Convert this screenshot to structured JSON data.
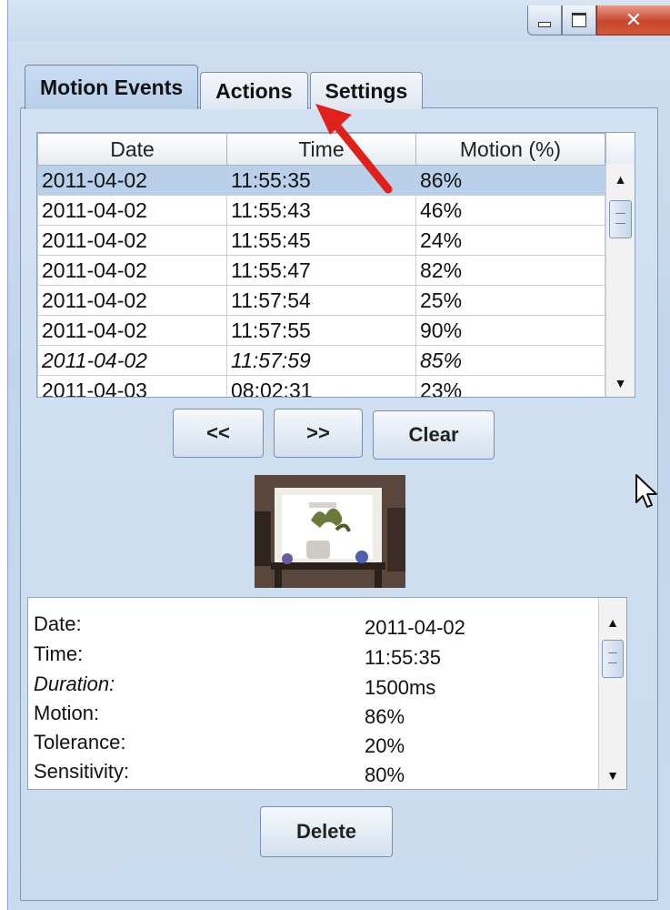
{
  "window": {
    "minimize_icon": "minimize-icon",
    "maximize_icon": "restore-icon",
    "close_label": "✕"
  },
  "tabs": [
    {
      "label": "Motion Events",
      "active": true
    },
    {
      "label": "Actions",
      "active": false
    },
    {
      "label": "Settings",
      "active": false
    }
  ],
  "events_table": {
    "columns": [
      "Date",
      "Time",
      "Motion (%)"
    ],
    "rows": [
      {
        "date": "2011-04-02",
        "time": "11:55:35",
        "motion": "86%",
        "selected": true
      },
      {
        "date": "2011-04-02",
        "time": "11:55:43",
        "motion": "46%"
      },
      {
        "date": "2011-04-02",
        "time": "11:55:45",
        "motion": "24%"
      },
      {
        "date": "2011-04-02",
        "time": "11:55:47",
        "motion": "82%"
      },
      {
        "date": "2011-04-02",
        "time": "11:57:54",
        "motion": "25%"
      },
      {
        "date": "2011-04-02",
        "time": "11:57:55",
        "motion": "90%"
      },
      {
        "date": "2011-04-02",
        "time": "11:57:59",
        "motion": "85%"
      },
      {
        "date": "2011-04-03",
        "time": "08:02:31",
        "motion": "23%"
      }
    ]
  },
  "nav_buttons": {
    "prev_label": "<<",
    "next_label": ">>",
    "clear_label": "Clear"
  },
  "details": [
    {
      "key": "Date:",
      "value": "2011-04-02"
    },
    {
      "key": "Time:",
      "value": "11:55:35"
    },
    {
      "key": "Duration:",
      "value": "1500ms"
    },
    {
      "key": "Motion:",
      "value": "86%"
    },
    {
      "key": "Tolerance:",
      "value": "20%"
    },
    {
      "key": "Sensitivity:",
      "value": "80%"
    }
  ],
  "delete_label": "Delete",
  "colors": {
    "selection": "#b9cfea",
    "annotation_arrow": "#e0201a",
    "close_button": "#c8452c"
  }
}
